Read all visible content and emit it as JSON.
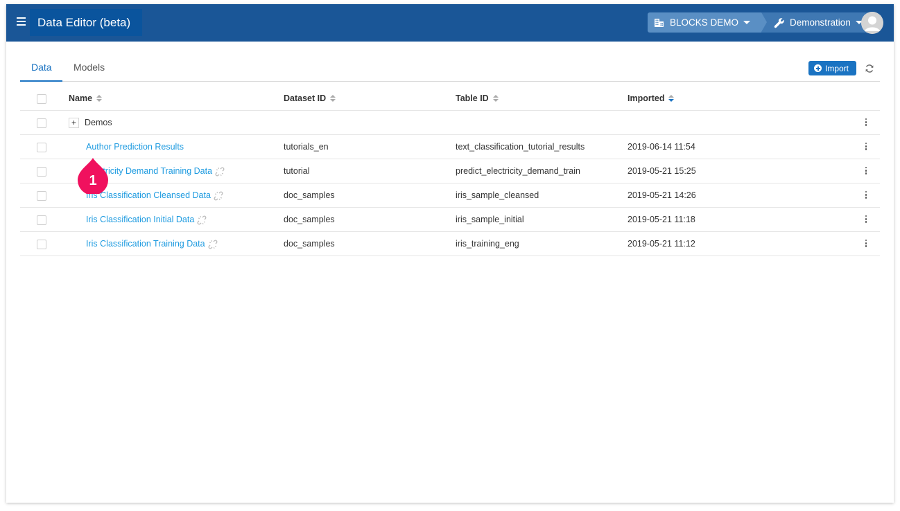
{
  "header": {
    "app_title": "Data Editor (beta)",
    "org_name": "BLOCKS DEMO",
    "project_name": "Demonstration",
    "colors": {
      "topbar": "#1a5697",
      "accent": "#1a73c2",
      "link": "#1e9be0",
      "marker": "#f0115e"
    }
  },
  "tabs": [
    {
      "label": "Data",
      "active": true
    },
    {
      "label": "Models",
      "active": false
    }
  ],
  "toolbar": {
    "import_label": "Import",
    "refresh_icon": "refresh-icon"
  },
  "table": {
    "columns": [
      {
        "label": "Name",
        "sort": "none"
      },
      {
        "label": "Dataset ID",
        "sort": "none"
      },
      {
        "label": "Table ID",
        "sort": "none"
      },
      {
        "label": "Imported",
        "sort": "desc"
      }
    ],
    "group_row": {
      "expand_label": "+",
      "name": "Demos"
    },
    "rows": [
      {
        "name": "Author Prediction Results",
        "dataset_id": "tutorials_en",
        "table_id": "text_classification_tutorial_results",
        "imported": "2019-06-14 11:54",
        "unlinked": false
      },
      {
        "name": "Electricity Demand Training Data",
        "dataset_id": "tutorial",
        "table_id": "predict_electricity_demand_train",
        "imported": "2019-05-21 15:25",
        "unlinked": true
      },
      {
        "name": "Iris Classification Cleansed Data",
        "dataset_id": "doc_samples",
        "table_id": "iris_sample_cleansed",
        "imported": "2019-05-21 14:26",
        "unlinked": true
      },
      {
        "name": "Iris Classification Initial Data",
        "dataset_id": "doc_samples",
        "table_id": "iris_sample_initial",
        "imported": "2019-05-21 11:18",
        "unlinked": true
      },
      {
        "name": "Iris Classification Training Data",
        "dataset_id": "doc_samples",
        "table_id": "iris_training_eng",
        "imported": "2019-05-21 11:12",
        "unlinked": true
      }
    ]
  },
  "annotation": {
    "marker_number": "1"
  }
}
